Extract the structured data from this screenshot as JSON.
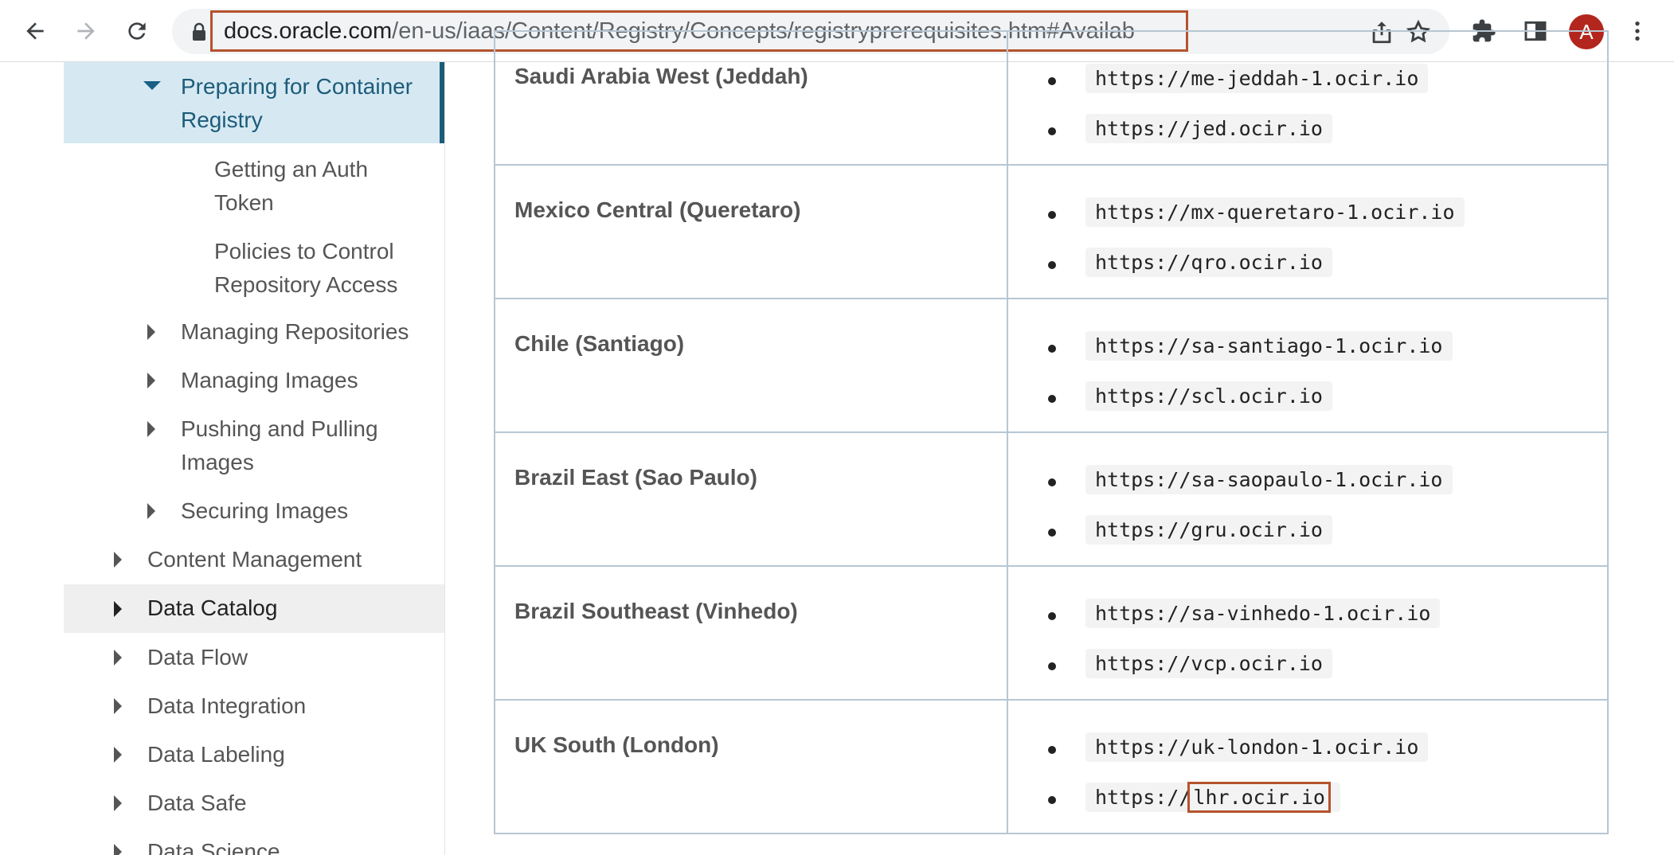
{
  "browser": {
    "url_host": "docs.oracle.com",
    "url_path": "/en-us/iaas/Content/Registry/Concepts/registryprerequisites.htm#Availab",
    "avatar_letter": "A",
    "highlight_color": "#b5532c"
  },
  "sidebar": {
    "items": [
      {
        "label": "Preparing for Container Registry",
        "state": "active",
        "arrow": "down"
      },
      {
        "label": "Getting an Auth Token",
        "arrow": "none"
      },
      {
        "label": "Policies to Control Repository Access",
        "arrow": "none"
      },
      {
        "label": "Managing Repositories",
        "arrow": "right"
      },
      {
        "label": "Managing Images",
        "arrow": "right"
      },
      {
        "label": "Pushing and Pulling Images",
        "arrow": "right"
      },
      {
        "label": "Securing Images",
        "arrow": "right"
      },
      {
        "label": "Content Management",
        "arrow": "right"
      },
      {
        "label": "Data Catalog",
        "state": "hover",
        "arrow": "right"
      },
      {
        "label": "Data Flow",
        "arrow": "right"
      },
      {
        "label": "Data Integration",
        "arrow": "right"
      },
      {
        "label": "Data Labeling",
        "arrow": "right"
      },
      {
        "label": "Data Safe",
        "arrow": "right"
      },
      {
        "label": "Data Science",
        "arrow": "right"
      }
    ]
  },
  "table": {
    "rows": [
      {
        "region": "Saudi Arabia West (Jeddah)",
        "endpoints": [
          "https://me-jeddah-1.ocir.io",
          "https://jed.ocir.io"
        ]
      },
      {
        "region": "Mexico Central (Queretaro)",
        "endpoints": [
          "https://mx-queretaro-1.ocir.io",
          "https://qro.ocir.io"
        ]
      },
      {
        "region": "Chile (Santiago)",
        "endpoints": [
          "https://sa-santiago-1.ocir.io",
          "https://scl.ocir.io"
        ]
      },
      {
        "region": "Brazil East (Sao Paulo)",
        "endpoints": [
          "https://sa-saopaulo-1.ocir.io",
          "https://gru.ocir.io"
        ]
      },
      {
        "region": "Brazil Southeast (Vinhedo)",
        "endpoints": [
          "https://sa-vinhedo-1.ocir.io",
          "https://vcp.ocir.io"
        ]
      },
      {
        "region": "UK South (London)",
        "endpoints": [
          "https://uk-london-1.ocir.io",
          "https://lhr.ocir.io"
        ]
      }
    ],
    "highlighted_endpoint": {
      "prefix": "https://",
      "boxed": "lhr.ocir.io"
    }
  }
}
